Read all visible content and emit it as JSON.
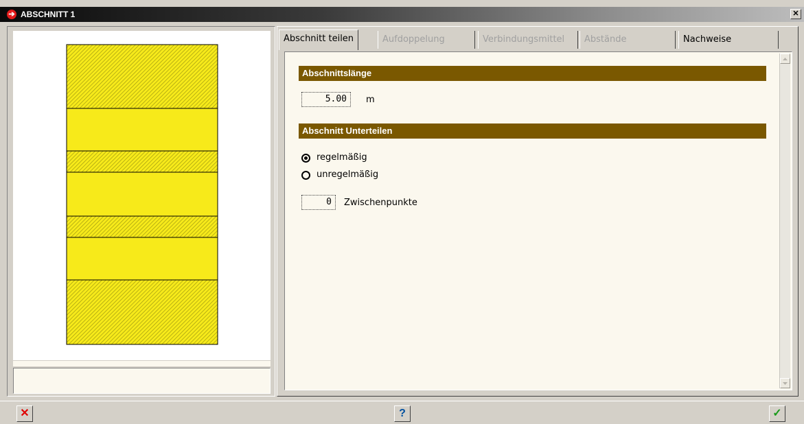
{
  "window": {
    "title": "ABSCHNITT 1"
  },
  "tabs": [
    {
      "label": "Abschnitt teilen",
      "state": "active"
    },
    {
      "label": "Aufdoppelung",
      "state": "disabled"
    },
    {
      "label": "Verbindungsmittel",
      "state": "disabled"
    },
    {
      "label": "Abstände",
      "state": "disabled"
    },
    {
      "label": "Nachweise",
      "state": "normal"
    }
  ],
  "section_length": {
    "title": "Abschnittslänge",
    "value": "5.00",
    "unit": "m"
  },
  "subdivide": {
    "title": "Abschnitt Unterteilen",
    "options": [
      {
        "label": "regelmäßig",
        "checked": true
      },
      {
        "label": "unregelmäßig",
        "checked": false
      }
    ],
    "points_value": "0",
    "points_label": "Zwischenpunkte"
  },
  "preview": {
    "layers": [
      {
        "pattern": "hatched"
      },
      {
        "pattern": "solid"
      },
      {
        "pattern": "hatched"
      },
      {
        "pattern": "solid"
      },
      {
        "pattern": "hatched"
      },
      {
        "pattern": "solid"
      },
      {
        "pattern": "hatched"
      }
    ],
    "colors": {
      "fill": "#f7ea1a",
      "hatch": "#a09a10"
    }
  },
  "bottom": {
    "cancel_icon": "red-x-icon",
    "help_icon": "help-icon",
    "ok_icon": "green-check-icon",
    "help_glyph": "?",
    "cancel_glyph": "✕",
    "ok_glyph": "✓"
  }
}
